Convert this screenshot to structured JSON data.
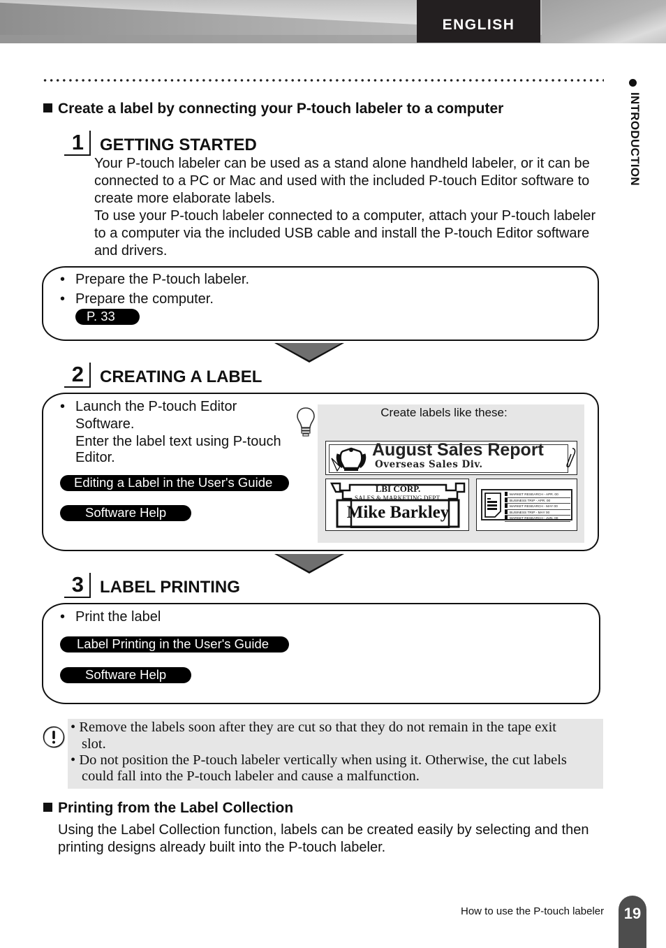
{
  "header": {
    "language_tab": "ENGLISH"
  },
  "side_tab": {
    "label": "INTRODUCTION"
  },
  "section_connect": {
    "title": "Create a label by connecting your P-touch labeler to a computer"
  },
  "steps": [
    {
      "number": "1",
      "title": "GETTING STARTED",
      "paragraphs": [
        "Your P-touch labeler can be used as a stand alone handheld labeler, or it can be connected to a PC or Mac and used with the included P-touch Editor software to create more elaborate labels.",
        "To use your P-touch labeler connected to a computer, attach your P-touch labeler to a computer via the included USB cable and install the P-touch Editor software and drivers."
      ],
      "bullets": [
        "Prepare the P-touch labeler.",
        "Prepare the computer."
      ],
      "links": [
        "P. 33"
      ]
    },
    {
      "number": "2",
      "title": "CREATING A LABEL",
      "bullets": [
        "Launch the P-touch Editor Software."
      ],
      "extra_lines": [
        "Software.",
        "Enter the label text using P-touch",
        "Editor."
      ],
      "first_line": "Launch the P-touch Editor",
      "links": [
        "Editing a Label in the User's Guide",
        "Software Help"
      ],
      "hint": {
        "icon": "lightbulb-icon",
        "caption": "Create labels like these:"
      },
      "sample_labels": {
        "report": {
          "title": "August Sales Report",
          "subtitle": "Overseas Sales Div."
        },
        "name_badge": {
          "company": "LBI CORP.",
          "department": "SALES & MARKETING DEPT.",
          "name": "Mike Barkley"
        },
        "file_index": {
          "rows": [
            "MARKET RESEARCH - APR. 00",
            "BUSINESS TRIP - APR. 00",
            "MARKET RESEARCH - MAY 00",
            "BUSINESS TRIP - MAY 00",
            "MARKET RESEARCH - JUN. 00"
          ]
        }
      }
    },
    {
      "number": "3",
      "title": "LABEL PRINTING",
      "bullets": [
        "Print the label"
      ],
      "links": [
        "Label Printing in the User's Guide",
        "Software Help"
      ]
    }
  ],
  "caution": {
    "icon": "caution-icon",
    "items": [
      {
        "line1": "Remove the labels soon after they are cut so that they do not remain in the tape exit",
        "line2": "slot."
      },
      {
        "line1": "Do not position the P-touch labeler vertically when using it. Otherwise, the cut labels",
        "line2": "could fall into the P-touch labeler and cause a malfunction."
      }
    ]
  },
  "section_collection": {
    "title": "Printing from the Label Collection",
    "body_line1": "Using the Label Collection function, labels can be created easily by selecting and then",
    "body_line2": "printing designs already built into the P-touch labeler."
  },
  "footer": {
    "chapter": "How to use the P-touch labeler",
    "page_number": "19"
  }
}
